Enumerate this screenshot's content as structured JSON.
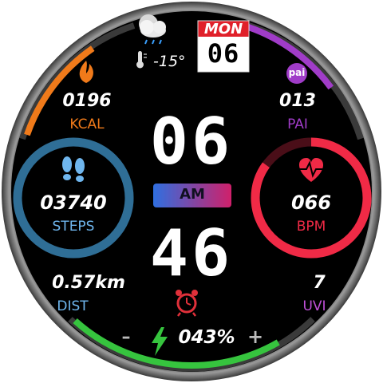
{
  "weather": {
    "icon": "cloudy-night-rain-icon",
    "temperature": "-15°",
    "thermometer_icon": "thermometer-icon"
  },
  "date": {
    "day": "MON",
    "date": "06"
  },
  "time": {
    "hour": "06",
    "minute": "46",
    "ampm": "AM"
  },
  "calories": {
    "value": "0196",
    "label": "KCAL",
    "icon": "flame-icon",
    "color": "#f07a1a",
    "progress": 0.35
  },
  "pai": {
    "value": "013",
    "label": "PAI",
    "badge": "pai",
    "color": "#a03cc8",
    "progress": 0.3
  },
  "steps": {
    "value": "03740",
    "label": "STEPS",
    "icon": "footprints-icon",
    "color": "#2f6e96",
    "progress": 1.0
  },
  "heart_rate": {
    "value": "066",
    "label": "BPM",
    "icon": "heart-rate-icon",
    "color": "#f02a46",
    "progress": 0.85
  },
  "distance": {
    "value": "0.57km",
    "label": "DIST"
  },
  "uvi": {
    "value": "7",
    "label": "UVI"
  },
  "alarm": {
    "icon": "alarm-clock-icon"
  },
  "battery": {
    "value": "043%",
    "minus": "–",
    "plus": "+",
    "icon": "lightning-icon",
    "color": "#36c43e",
    "progress": 0.43
  }
}
